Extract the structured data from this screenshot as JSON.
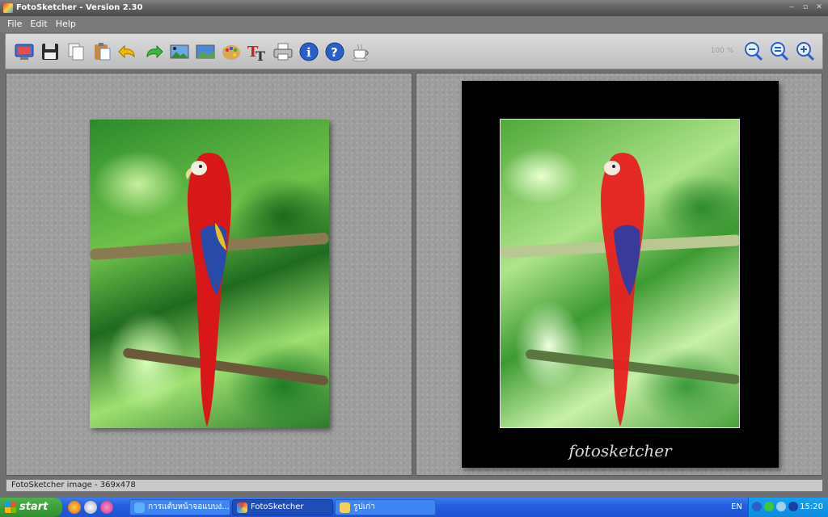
{
  "window": {
    "title": "FotoSketcher - Version 2.30",
    "buttons": [
      "‒",
      "▫",
      "✕"
    ]
  },
  "menu": [
    "File",
    "Edit",
    "Help"
  ],
  "toolbar": {
    "buttons": [
      {
        "name": "open-image-button",
        "icon": "monitor-picture-icon"
      },
      {
        "name": "save-button",
        "icon": "floppy-disk-icon"
      },
      {
        "name": "copy-button",
        "icon": "copy-pages-icon"
      },
      {
        "name": "paste-button",
        "icon": "clipboard-icon"
      },
      {
        "name": "undo-button",
        "icon": "undo-arrow-icon"
      },
      {
        "name": "redo-button",
        "icon": "redo-arrow-icon"
      },
      {
        "name": "image-filter-button",
        "icon": "landscape-image-icon"
      },
      {
        "name": "image-adjust-button",
        "icon": "landscape-image-icon"
      },
      {
        "name": "painting-effects-button",
        "icon": "palette-icon"
      },
      {
        "name": "add-text-button",
        "icon": "text-tt-icon"
      },
      {
        "name": "print-button",
        "icon": "printer-icon"
      },
      {
        "name": "info-button",
        "icon": "info-icon"
      },
      {
        "name": "help-button",
        "icon": "help-icon"
      },
      {
        "name": "donate-button",
        "icon": "coffee-cup-icon"
      },
      {
        "name": "zoom-out-button",
        "icon": "zoom-out-icon"
      },
      {
        "name": "zoom-reset-button",
        "icon": "zoom-reset-icon"
      },
      {
        "name": "zoom-in-button",
        "icon": "zoom-in-icon"
      }
    ],
    "zoom_label": "100 %"
  },
  "sketch": {
    "signature": "fotosketcher"
  },
  "status": {
    "text": "FotoSketcher image - 369x478"
  },
  "taskbar": {
    "start_label": "start",
    "tasks": [
      {
        "label": "การแต้บหน้าจอแบบง่...",
        "active": false
      },
      {
        "label": "FotoSketcher",
        "active": true
      },
      {
        "label": "รูปเก่า",
        "active": false
      }
    ],
    "language": "EN",
    "clock": "15:20"
  },
  "colors": {
    "toolbar": "#cccccc",
    "panel": "#9d9d9d",
    "taskbar": "#245ee0",
    "start": "#2f8f2f"
  }
}
